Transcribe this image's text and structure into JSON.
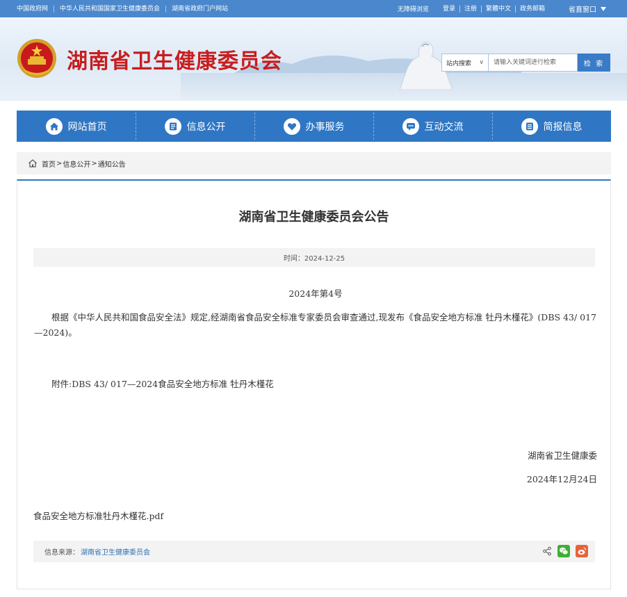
{
  "topbar": {
    "left_links": [
      "中国政府网",
      "中华人民共和国国家卫生健康委员会",
      "湖南省政府门户网站"
    ],
    "right_links": [
      "无障碍浏览",
      "登录",
      "注册",
      "繁體中文",
      "政务邮箱"
    ],
    "region_label": "省直窗口"
  },
  "header": {
    "site_title": "湖南省卫生健康委员会",
    "search_scope": "站内搜索",
    "search_placeholder": "请输入关键词进行检索",
    "search_button": "检 索"
  },
  "nav": {
    "items": [
      {
        "label": "网站首页",
        "icon": "home-icon"
      },
      {
        "label": "信息公开",
        "icon": "document-icon"
      },
      {
        "label": "办事服务",
        "icon": "heart-icon"
      },
      {
        "label": "互动交流",
        "icon": "chat-icon"
      },
      {
        "label": "简报信息",
        "icon": "list-icon"
      }
    ]
  },
  "breadcrumb": {
    "items": [
      "首页",
      "信息公开",
      "通知公告"
    ],
    "separator": ">"
  },
  "article": {
    "title": "湖南省卫生健康委员会公告",
    "time": "时间：2024-12-25",
    "number": "2024年第4号",
    "paragraph": "根据《中华人民共和国食品安全法》规定,经湖南省食品安全标准专家委员会审查通过,现发布《食品安全地方标准 牡丹木槿花》(DBS 43/ 017—2024)。",
    "attachment": "附件:DBS 43/ 017—2024食品安全地方标准 牡丹木槿花",
    "signature_org": "湖南省卫生健康委",
    "signature_date": "2024年12月24日",
    "file_name": "食品安全地方标准牡丹木槿花.pdf",
    "source_label": "信息来源：",
    "source_org": "湖南省卫生健康委员会"
  },
  "colors": {
    "topbar": "#4a87cc",
    "nav": "#2f77c4",
    "title_red": "#c81d1d",
    "wechat": "#3cb034",
    "weibo": "#e8623a"
  }
}
